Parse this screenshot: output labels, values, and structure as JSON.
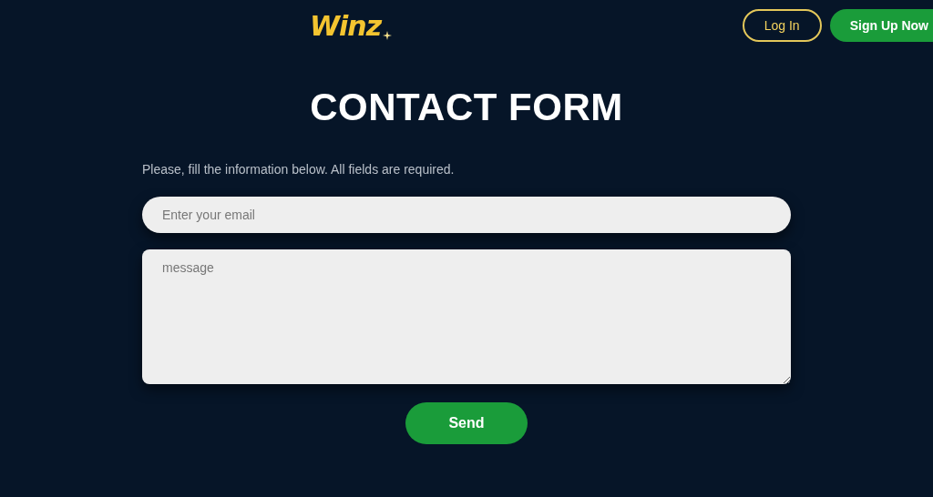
{
  "header": {
    "logo": "Winz",
    "buttons": [
      {
        "kind": "outline",
        "label": "Log In"
      },
      {
        "kind": "primary",
        "label": "Sign Up Now"
      }
    ]
  },
  "title": "CONTACT FORM",
  "form": {
    "intro": "Please, fill the information below. All fields are required.",
    "email": {
      "placeholder": "Enter your email"
    },
    "message": {
      "placeholder": "message"
    },
    "submit": "Send"
  }
}
